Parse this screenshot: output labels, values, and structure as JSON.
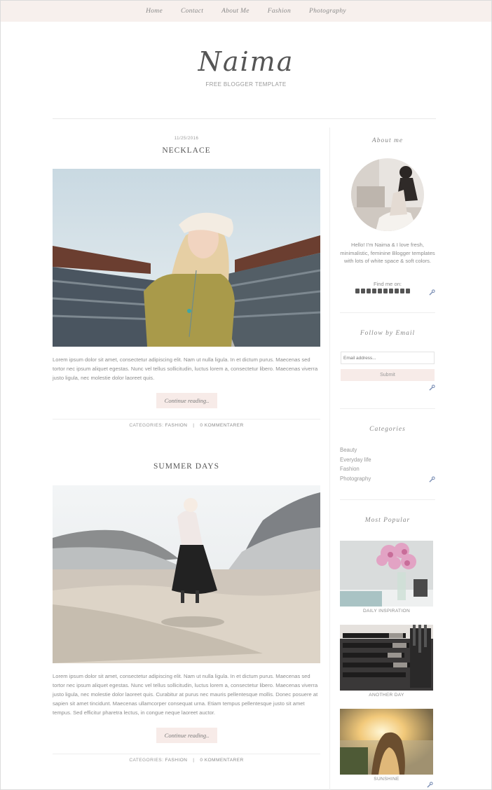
{
  "nav": {
    "items": [
      "Home",
      "Contact",
      "About Me",
      "Fashion",
      "Photography"
    ]
  },
  "header": {
    "logo": "Naima",
    "tagline": "FREE BLOGGER TEMPLATE"
  },
  "posts": [
    {
      "date": "11/25/2016",
      "title": "NECKLACE",
      "text": "Lorem ipsum dolor sit amet, consectetur adipiscing elit. Nam ut nulla ligula. In et dictum purus. Maecenas sed tortor nec ipsum aliquet egestas. Nunc vel tellus sollicitudin, luctus lorem a, consectetur libero. Maecenas viverra justo ligula, nec molestie dolor laoreet quis.",
      "button": "Continue reading..",
      "categories_label": "CATEGORIES:",
      "category": "FASHION",
      "separator": "|",
      "comments": "0 KOMMENTARER"
    },
    {
      "title": "SUMMER DAYS",
      "text": "Lorem ipsum dolor sit amet, consectetur adipiscing elit. Nam ut nulla ligula. In et dictum purus. Maecenas sed tortor nec ipsum aliquet egestas. Nunc vel tellus sollicitudin, luctus lorem a, consectetur libero. Maecenas viverra justo ligula, nec molestie dolor laoreet quis. Curabitur at purus nec mauris pellentesque mollis. Donec posuere at sapien sit amet tincidunt. Maecenas ullamcorper consequat urna. Etiam tempus pellentesque justo sit amet tempus. Sed efficitur pharetra lectus, in congue neque laoreet auctor.",
      "button": "Continue reading..",
      "categories_label": "CATEGORIES:",
      "category": "FASHION",
      "separator": "|",
      "comments": "0 KOMMENTARER"
    }
  ],
  "sidebar": {
    "about": {
      "title": "About me",
      "text": "Hello! I'm Naima & I love fresh, minimalistic, feminine Blogger templates with lots of white space & soft colors.",
      "findme": "Find me on:"
    },
    "social_icons": [
      "twitter-icon",
      "facebook-icon",
      "instagram-icon",
      "google-plus-icon",
      "heart-icon",
      "pinterest-icon",
      "youtube-icon",
      "tumblr-icon",
      "rss-icon",
      "envelope-icon"
    ],
    "follow": {
      "title": "Follow by Email",
      "placeholder": "Email address...",
      "submit": "Submit"
    },
    "categories": {
      "title": "Categories",
      "items": [
        "Beauty",
        "Everyday life",
        "Fashion",
        "Photography"
      ]
    },
    "popular": {
      "title": "Most Popular",
      "items": [
        {
          "caption": "DAILY INSPIRATION"
        },
        {
          "caption": "ANOTHER DAY"
        },
        {
          "caption": "SUNSHINE"
        }
      ]
    }
  },
  "colors": {
    "nav_bg": "#f7f0ed",
    "button_bg": "#f7ebe8",
    "text": "#8d8d8d"
  }
}
